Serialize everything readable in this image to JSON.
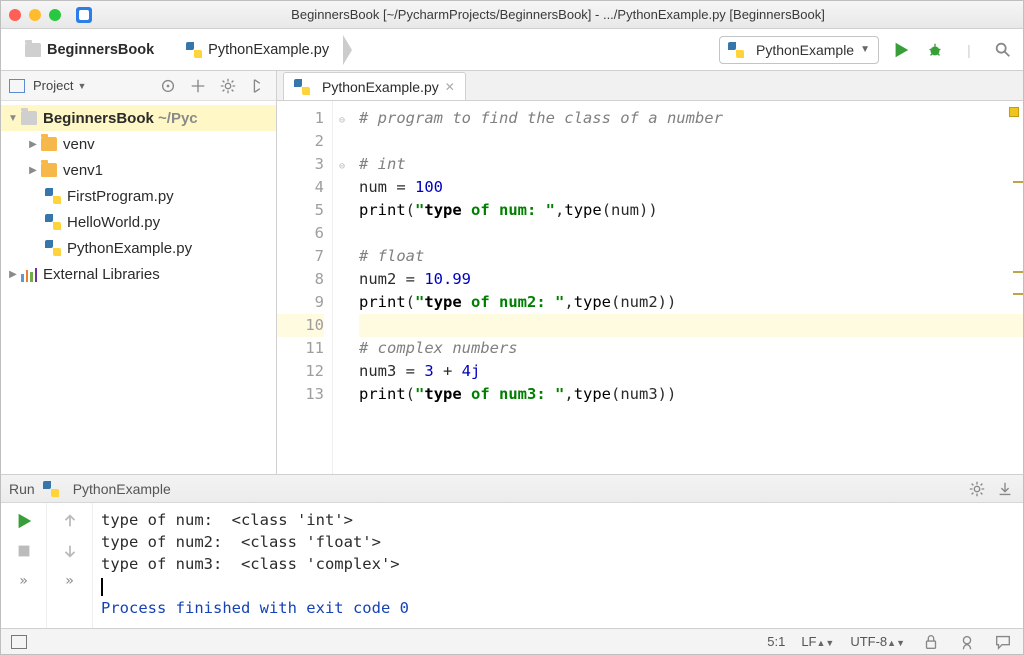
{
  "title": "BeginnersBook [~/PycharmProjects/BeginnersBook] - .../PythonExample.py [BeginnersBook]",
  "breadcrumbs": {
    "root": "BeginnersBook",
    "file": "PythonExample.py"
  },
  "run_config": "PythonExample",
  "project_panel": {
    "title": "Project"
  },
  "tree": {
    "root": {
      "name": "BeginnersBook",
      "path": "~/Pyc"
    },
    "items": [
      {
        "name": "venv"
      },
      {
        "name": "venv1"
      },
      {
        "name": "FirstProgram.py"
      },
      {
        "name": "HelloWorld.py"
      },
      {
        "name": "PythonExample.py"
      }
    ],
    "external": "External Libraries"
  },
  "editor_tab": "PythonExample.py",
  "code_lines": [
    "# program to find the class of a number",
    "",
    "# int",
    "num = 100",
    "print(\"type of num: \",type(num))",
    "",
    "# float",
    "num2 = 10.99",
    "print(\"type of num2: \",type(num2))",
    "",
    "# complex numbers",
    "num3 = 3 + 4j",
    "print(\"type of num3: \",type(num3))"
  ],
  "gutter": [
    "1",
    "2",
    "3",
    "4",
    "5",
    "6",
    "7",
    "8",
    "9",
    "10",
    "11",
    "12",
    "13"
  ],
  "run_panel": {
    "label": "Run",
    "config": "PythonExample",
    "output": [
      "type of num:  <class 'int'>",
      "type of num2:  <class 'float'>",
      "type of num3:  <class 'complex'>"
    ],
    "exit": "Process finished with exit code 0"
  },
  "status": {
    "pos": "5:1",
    "le": "LF",
    "enc": "UTF-8"
  }
}
